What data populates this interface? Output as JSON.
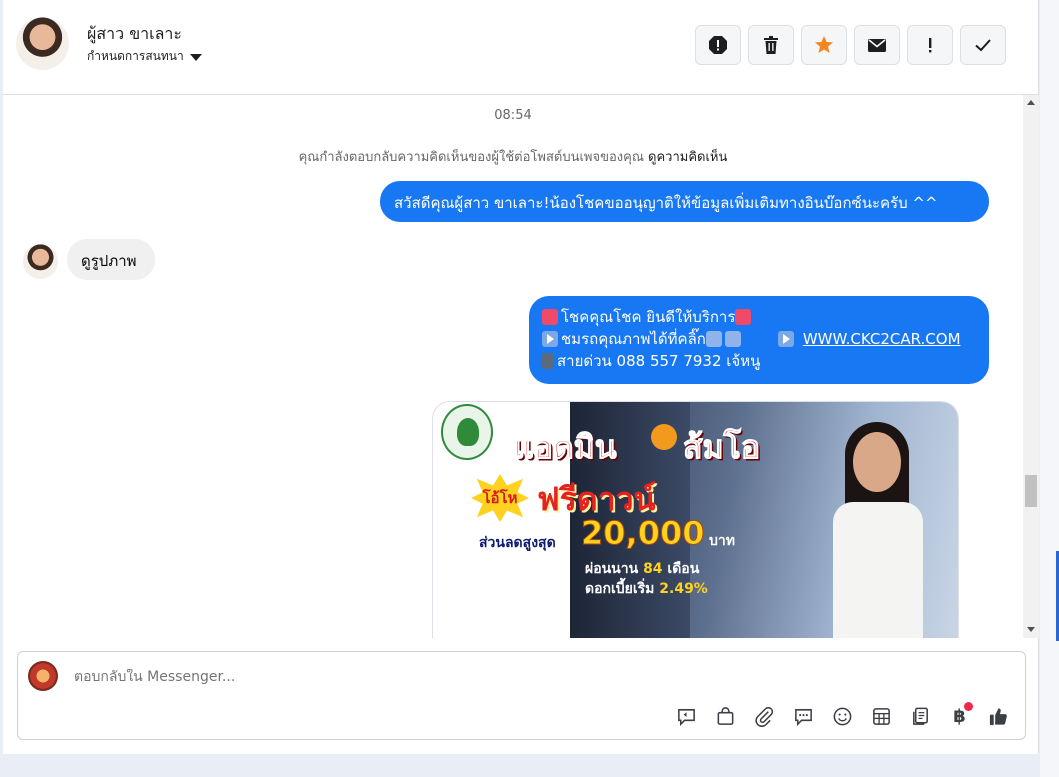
{
  "header": {
    "contact_name": "ผู้สาว ขาเลาะ",
    "assign_label": "กำหนดการสนทนา",
    "actions": [
      {
        "name": "report-icon"
      },
      {
        "name": "trash-icon"
      },
      {
        "name": "star-icon"
      },
      {
        "name": "mail-icon"
      },
      {
        "name": "alert-icon"
      },
      {
        "name": "check-icon"
      }
    ]
  },
  "conversation": {
    "time": "08:54",
    "notice_text": "คุณกำลังตอบกลับความคิดเห็นของผู้ใช้ต่อโพสต์บนเพจของคุณ",
    "notice_link": "ดูความคิดเห็น",
    "messages": [
      {
        "direction": "out",
        "text": "สวัสดีคุณผู้สาว ขาเลาะ!น้องโชคขออนุญาติให้ข้อมูลเพิ่มเติมทางอินบ๊อกซ์นะครับ ^^"
      },
      {
        "direction": "in",
        "text": "ดูรูปภาพ"
      },
      {
        "direction": "out",
        "line1": "โชคคุณโชค ยินดีให้บริการ",
        "line2_text": "ชมรถคุณภาพได้ที่คลิ๊ก",
        "line2_link": "WWW.CKC2CAR.COM",
        "line3": "สายด่วน 088 557 7932 เจ้หนู"
      }
    ],
    "promo": {
      "title_1": "แอดมิน",
      "title_1b": "ส้มโอ",
      "burst": "โอ้โห",
      "title_2": "ฟรีดาวน์",
      "discount_label": "ส่วนลดสูงสุด",
      "discount_value": "20,000",
      "currency": "บาท",
      "installment_prefix": "ผ่อนนาน",
      "installment_months": "84",
      "installment_suffix": "เดือน",
      "interest_prefix": "ดอกเบี้ยเริ่ม",
      "interest_rate": "2.49%"
    }
  },
  "composer": {
    "placeholder": "ตอบกลับใน Messenger...",
    "tools": [
      "reply-icon",
      "bag-icon",
      "attach-icon",
      "chat-icon",
      "emoji-icon",
      "table-icon",
      "notes-icon",
      "baht-icon",
      "like-icon"
    ],
    "baht_symbol": "฿"
  },
  "colors": {
    "accent": "#1877f2",
    "star": "#f5871f",
    "notification": "#f02849"
  }
}
